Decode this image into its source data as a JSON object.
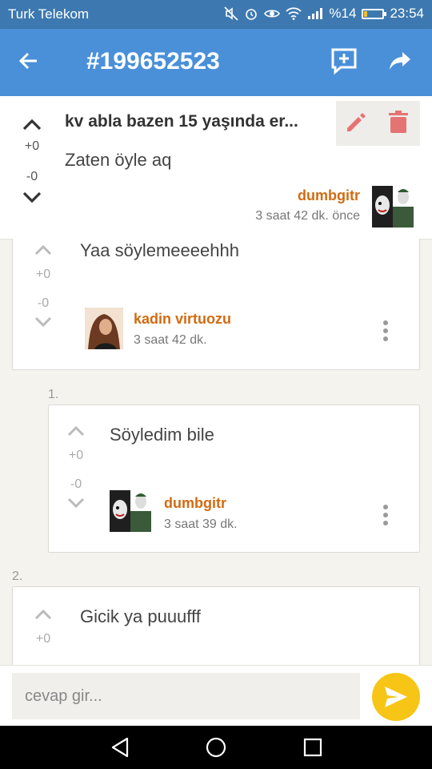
{
  "status_bar": {
    "carrier": "Turk Telekom",
    "battery": "%14",
    "time": "23:54",
    "battery_level": 0.14
  },
  "app_bar": {
    "title": "#199652523"
  },
  "post": {
    "title": "kv abla bazen 15 yaşında er...",
    "body": "Zaten öyle aq",
    "up_count": "+0",
    "down_count": "-0",
    "author": "dumbgitr",
    "time": "3 saat 42 dk. önce"
  },
  "replies": [
    {
      "number": "",
      "text": "Yaa söylemeeeehhh",
      "up_count": "+0",
      "down_count": "-0",
      "author": "kadin virtuozu",
      "time": "3 saat 42 dk."
    },
    {
      "number": "1.",
      "text": "Söyledim bile",
      "up_count": "+0",
      "down_count": "-0",
      "author": "dumbgitr",
      "time": "3 saat 39 dk."
    },
    {
      "number": "2.",
      "text": "Gicik ya puuufff",
      "up_count": "+0"
    }
  ],
  "input": {
    "placeholder": "cevap gir..."
  },
  "colors": {
    "app_bar": "#4a90d9",
    "status_bar": "#3d79b0",
    "author": "#d16b12",
    "action_icons": "#e57373",
    "send_button": "#f6c515"
  }
}
